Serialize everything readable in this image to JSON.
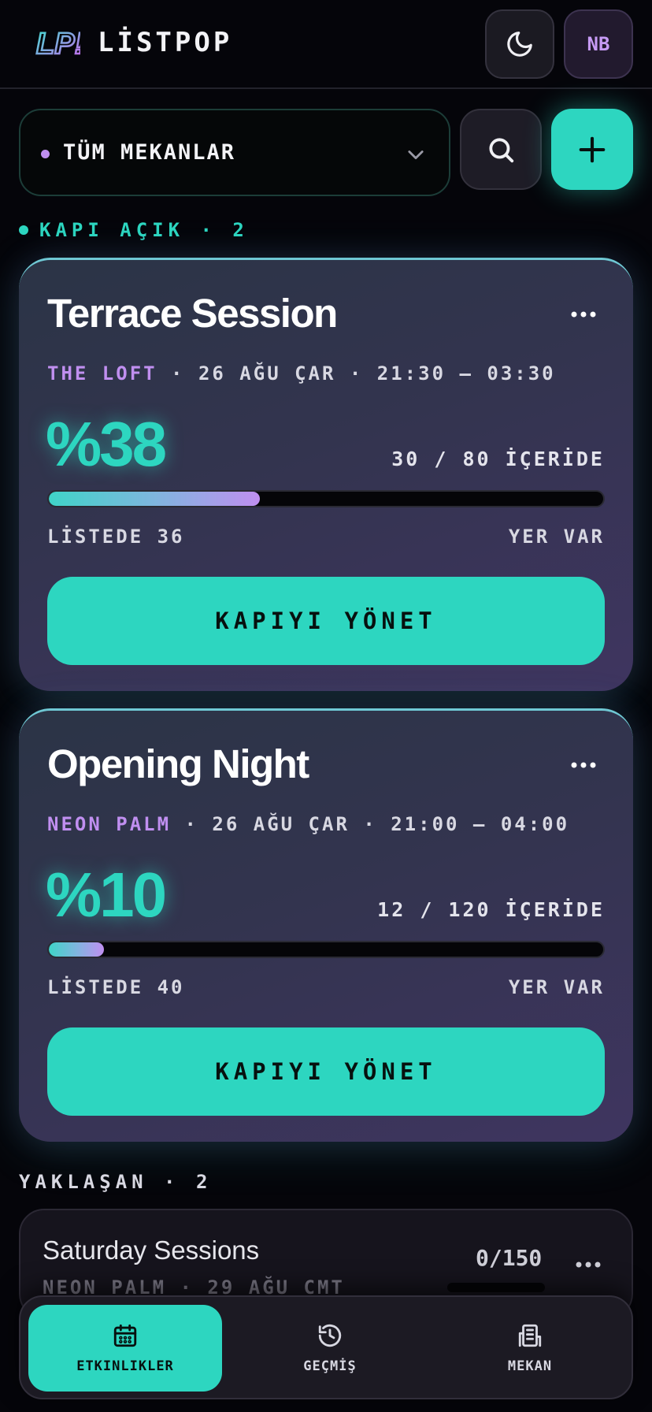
{
  "header": {
    "brand": "LİSTPOP",
    "avatar_initials": "NB"
  },
  "controls": {
    "venue_filter": "TÜM MEKANLAR"
  },
  "sections": {
    "open_label": "KAPI AÇIK · 2",
    "upcoming_label": "YAKLAŞAN · 2"
  },
  "events_open": [
    {
      "title": "Terrace Session",
      "venue": "THE LOFT",
      "details": " · 26 AĞU ÇAR · 21:30 — 03:30",
      "percent": "%38",
      "capacity": "30 / 80 İÇERİDE",
      "fill_fraction": 0.38,
      "on_list": "LİSTEDE 36",
      "status": "YER VAR",
      "action": "KAPIYI YÖNET"
    },
    {
      "title": "Opening Night",
      "venue": "NEON PALM",
      "details": " · 26 AĞU ÇAR · 21:00 — 04:00",
      "percent": "%10",
      "capacity": "12 / 120 İÇERİDE",
      "fill_fraction": 0.1,
      "on_list": "LİSTEDE 40",
      "status": "YER VAR",
      "action": "KAPIYI YÖNET"
    }
  ],
  "events_upcoming": [
    {
      "title": "Saturday Sessions",
      "meta": "NEON PALM · 29 AĞU CMT",
      "count": "0/150"
    }
  ],
  "nav": {
    "events": "ETKINLIKLER",
    "history": "GEÇMİŞ",
    "venue": "MEKAN"
  },
  "colors": {
    "accent": "#2dd6c0",
    "purple": "#c08ff0",
    "background": "#05050a"
  },
  "icons": [
    "logo-icon",
    "moon-icon",
    "chevron-down-icon",
    "search-icon",
    "plus-icon",
    "more-icon",
    "calendar-icon",
    "history-icon",
    "building-icon"
  ]
}
